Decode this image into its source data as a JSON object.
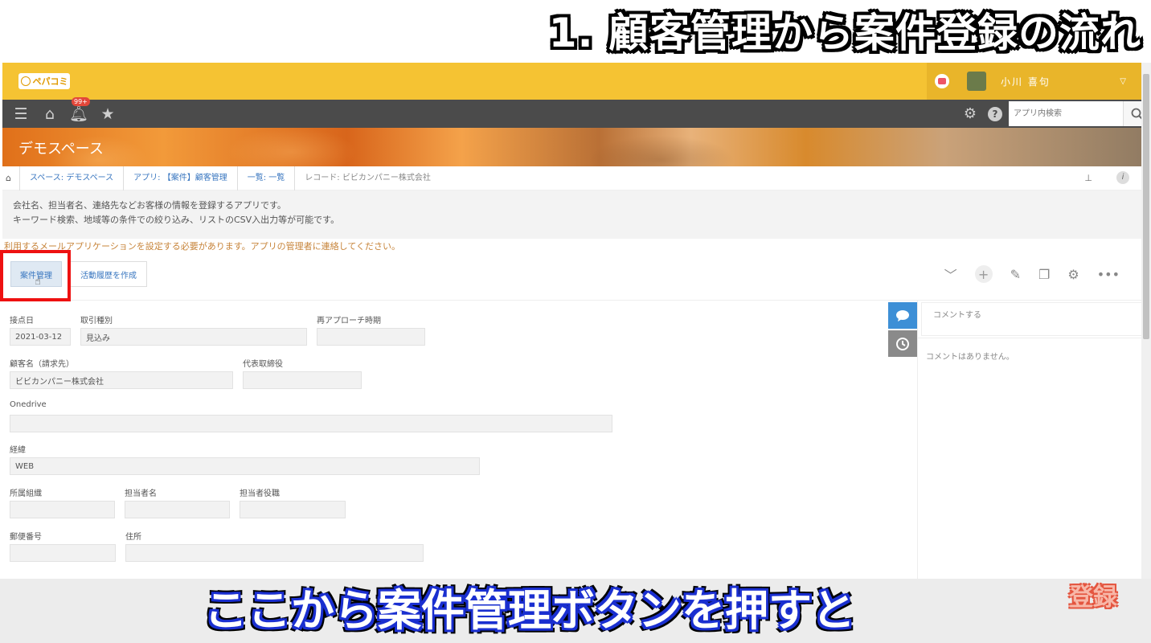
{
  "overlay": {
    "title": "1. 顧客管理から案件登録の流れ",
    "subtitle": "ここから案件管理ボタンを押すと",
    "stamp": "登録"
  },
  "header": {
    "logo_text": "ペパコミ",
    "user_name": "小川 喜句"
  },
  "toolbar": {
    "notification_badge": "99+",
    "search_placeholder": "アプリ内検索"
  },
  "space": {
    "title": "デモスペース"
  },
  "breadcrumb": {
    "items": [
      "スペース: デモスペース",
      "アプリ: 【案件】顧客管理",
      "一覧: 一覧",
      "レコード: ビビカンパニー株式会社"
    ]
  },
  "app_description": {
    "line1": "会社名、担当者名、連絡先などお客様の情報を登録するアプリです。",
    "line2": "キーワード検索、地域等の条件での絞り込み、リストのCSV入出力等が可能です。"
  },
  "warning": "利用するメールアプリケーションを設定する必要があります。アプリの管理者に連絡してください。",
  "actions": {
    "case_button": "案件管理",
    "activity_button": "活動履歴を作成"
  },
  "form": {
    "contact_date": {
      "label": "接点日",
      "value": "2021-03-12"
    },
    "deal_type": {
      "label": "取引種別",
      "value": "見込み"
    },
    "reapproach": {
      "label": "再アプローチ時期",
      "value": ""
    },
    "customer_name": {
      "label": "顧客名（請求先）",
      "value": "ビビカンパニー株式会社"
    },
    "representative": {
      "label": "代表取締役",
      "value": ""
    },
    "onedrive": {
      "label": "Onedrive",
      "value": ""
    },
    "source": {
      "label": "経緯",
      "value": "WEB"
    },
    "department": {
      "label": "所属組織",
      "value": ""
    },
    "person": {
      "label": "担当者名",
      "value": ""
    },
    "person_title": {
      "label": "担当者役職",
      "value": ""
    },
    "postal": {
      "label": "郵便番号",
      "value": ""
    },
    "address": {
      "label": "住所",
      "value": ""
    }
  },
  "comments": {
    "input_placeholder": "コメントする",
    "empty_text": "コメントはありません。"
  },
  "colors": {
    "header_yellow": "#f5c333",
    "toolbar_dark": "#4b4b4b",
    "highlight_red": "#ee1111",
    "link_blue": "#3a77c0"
  }
}
